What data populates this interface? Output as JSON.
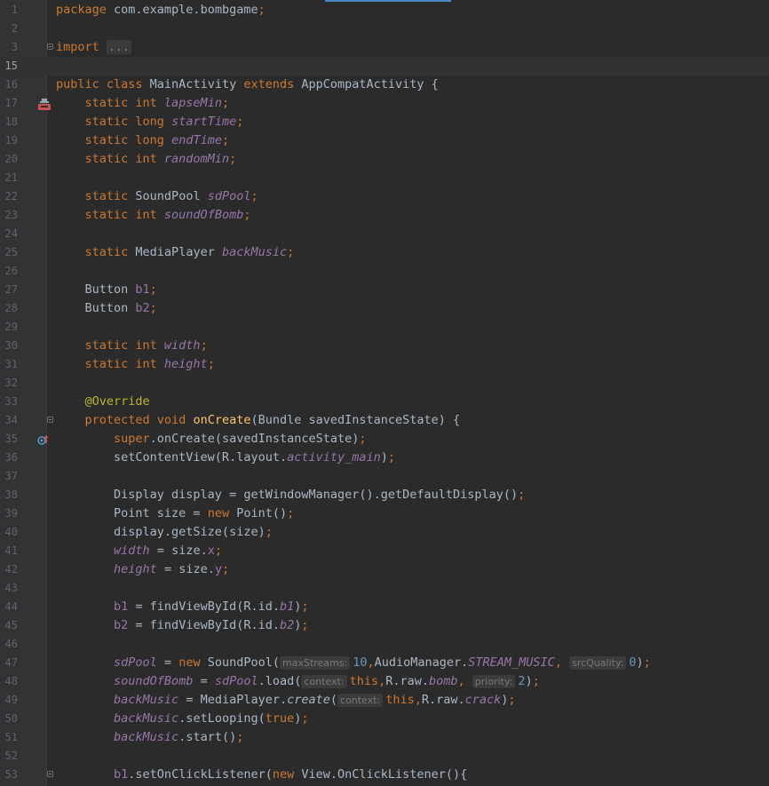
{
  "editor": {
    "lines": [
      {
        "n": "1",
        "tokens": [
          [
            "kw",
            "package "
          ],
          [
            "",
            "com.example.bombgame"
          ],
          [
            "kw",
            ";"
          ]
        ]
      },
      {
        "n": "2",
        "tokens": []
      },
      {
        "n": "3",
        "fold": true,
        "tokens": [
          [
            "kw",
            "import "
          ],
          [
            "folded",
            "..."
          ]
        ]
      },
      {
        "n": "15",
        "current": true,
        "tokens": []
      },
      {
        "n": "16",
        "icon": "class-icon",
        "tokens": [
          [
            "kw",
            "public class "
          ],
          [
            "",
            "MainActivity "
          ],
          [
            "kw",
            "extends "
          ],
          [
            "",
            "AppCompatActivity {"
          ]
        ]
      },
      {
        "n": "17",
        "tokens": [
          [
            "",
            "    "
          ],
          [
            "kw",
            "static int "
          ],
          [
            "fld",
            "lapseMin"
          ],
          [
            "kw",
            ";"
          ]
        ]
      },
      {
        "n": "18",
        "tokens": [
          [
            "",
            "    "
          ],
          [
            "kw",
            "static long "
          ],
          [
            "fld",
            "startTime"
          ],
          [
            "kw",
            ";"
          ]
        ]
      },
      {
        "n": "19",
        "tokens": [
          [
            "",
            "    "
          ],
          [
            "kw",
            "static long "
          ],
          [
            "fld",
            "endTime"
          ],
          [
            "kw",
            ";"
          ]
        ]
      },
      {
        "n": "20",
        "tokens": [
          [
            "",
            "    "
          ],
          [
            "kw",
            "static int "
          ],
          [
            "fld",
            "randomMin"
          ],
          [
            "kw",
            ";"
          ]
        ]
      },
      {
        "n": "21",
        "tokens": []
      },
      {
        "n": "22",
        "tokens": [
          [
            "",
            "    "
          ],
          [
            "kw",
            "static "
          ],
          [
            "",
            "SoundPool "
          ],
          [
            "fld",
            "sdPool"
          ],
          [
            "kw",
            ";"
          ]
        ]
      },
      {
        "n": "23",
        "tokens": [
          [
            "",
            "    "
          ],
          [
            "kw",
            "static int "
          ],
          [
            "fld",
            "soundOfBomb"
          ],
          [
            "kw",
            ";"
          ]
        ]
      },
      {
        "n": "24",
        "tokens": []
      },
      {
        "n": "25",
        "tokens": [
          [
            "",
            "    "
          ],
          [
            "kw",
            "static "
          ],
          [
            "",
            "MediaPlayer "
          ],
          [
            "fld",
            "backMusic"
          ],
          [
            "kw",
            ";"
          ]
        ]
      },
      {
        "n": "26",
        "tokens": []
      },
      {
        "n": "27",
        "tokens": [
          [
            "",
            "    Button "
          ],
          [
            "fldn",
            "b1"
          ],
          [
            "kw",
            ";"
          ]
        ]
      },
      {
        "n": "28",
        "tokens": [
          [
            "",
            "    Button "
          ],
          [
            "fldn",
            "b2"
          ],
          [
            "kw",
            ";"
          ]
        ]
      },
      {
        "n": "29",
        "tokens": []
      },
      {
        "n": "30",
        "tokens": [
          [
            "",
            "    "
          ],
          [
            "kw",
            "static int "
          ],
          [
            "fld",
            "width"
          ],
          [
            "kw",
            ";"
          ]
        ]
      },
      {
        "n": "31",
        "tokens": [
          [
            "",
            "    "
          ],
          [
            "kw",
            "static int "
          ],
          [
            "fld",
            "height"
          ],
          [
            "kw",
            ";"
          ]
        ]
      },
      {
        "n": "32",
        "tokens": []
      },
      {
        "n": "33",
        "tokens": [
          [
            "",
            "    "
          ],
          [
            "ann",
            "@Override"
          ]
        ]
      },
      {
        "n": "34",
        "icon": "override-icon",
        "fold": true,
        "tokens": [
          [
            "",
            "    "
          ],
          [
            "kw",
            "protected void "
          ],
          [
            "mth",
            "onCreate"
          ],
          [
            "",
            "(Bundle savedInstanceState) {"
          ]
        ]
      },
      {
        "n": "35",
        "tokens": [
          [
            "",
            "        "
          ],
          [
            "kw",
            "super"
          ],
          [
            "",
            ".onCreate(savedInstanceState)"
          ],
          [
            "kw",
            ";"
          ]
        ]
      },
      {
        "n": "36",
        "tokens": [
          [
            "",
            "        setContentView(R.layout."
          ],
          [
            "fld",
            "activity_main"
          ],
          [
            "",
            ")"
          ],
          [
            "kw",
            ";"
          ]
        ]
      },
      {
        "n": "37",
        "tokens": []
      },
      {
        "n": "38",
        "tokens": [
          [
            "",
            "        Display display = getWindowManager().getDefaultDisplay()"
          ],
          [
            "kw",
            ";"
          ]
        ]
      },
      {
        "n": "39",
        "tokens": [
          [
            "",
            "        Point size = "
          ],
          [
            "kw",
            "new "
          ],
          [
            "",
            "Point()"
          ],
          [
            "kw",
            ";"
          ]
        ]
      },
      {
        "n": "40",
        "tokens": [
          [
            "",
            "        display.getSize(size)"
          ],
          [
            "kw",
            ";"
          ]
        ]
      },
      {
        "n": "41",
        "tokens": [
          [
            "",
            "        "
          ],
          [
            "fld",
            "width "
          ],
          [
            "",
            "= size."
          ],
          [
            "fldn",
            "x"
          ],
          [
            "kw",
            ";"
          ]
        ]
      },
      {
        "n": "42",
        "tokens": [
          [
            "",
            "        "
          ],
          [
            "fld",
            "height "
          ],
          [
            "",
            "= size."
          ],
          [
            "fldn",
            "y"
          ],
          [
            "kw",
            ";"
          ]
        ]
      },
      {
        "n": "43",
        "tokens": []
      },
      {
        "n": "44",
        "tokens": [
          [
            "",
            "        "
          ],
          [
            "fldn",
            "b1 "
          ],
          [
            "",
            "= findViewById(R.id."
          ],
          [
            "fld",
            "b1"
          ],
          [
            "",
            ")"
          ],
          [
            "kw",
            ";"
          ]
        ]
      },
      {
        "n": "45",
        "tokens": [
          [
            "",
            "        "
          ],
          [
            "fldn",
            "b2 "
          ],
          [
            "",
            "= findViewById(R.id."
          ],
          [
            "fld",
            "b2"
          ],
          [
            "",
            ")"
          ],
          [
            "kw",
            ";"
          ]
        ]
      },
      {
        "n": "46",
        "tokens": []
      },
      {
        "n": "47",
        "tokens": [
          [
            "",
            "        "
          ],
          [
            "fld",
            "sdPool "
          ],
          [
            "",
            "= "
          ],
          [
            "kw",
            "new "
          ],
          [
            "",
            "SoundPool("
          ],
          [
            "hint",
            "maxStreams:"
          ],
          [
            "num",
            "10"
          ],
          [
            "kw",
            ","
          ],
          [
            "",
            "AudioManager."
          ],
          [
            "fld",
            "STREAM_MUSIC"
          ],
          [
            "kw",
            ", "
          ],
          [
            "hint",
            "srcQuality:"
          ],
          [
            "num",
            "0"
          ],
          [
            "",
            ")"
          ],
          [
            "kw",
            ";"
          ]
        ]
      },
      {
        "n": "48",
        "tokens": [
          [
            "",
            "        "
          ],
          [
            "fld",
            "soundOfBomb "
          ],
          [
            "",
            "= "
          ],
          [
            "fld",
            "sdPool"
          ],
          [
            "",
            ".load("
          ],
          [
            "hint",
            "context:"
          ],
          [
            "kw",
            "this,"
          ],
          [
            "",
            "R.raw."
          ],
          [
            "fld",
            "bomb"
          ],
          [
            "kw",
            ", "
          ],
          [
            "hint",
            "priority:"
          ],
          [
            "num",
            "2"
          ],
          [
            "",
            ")"
          ],
          [
            "kw",
            ";"
          ]
        ]
      },
      {
        "n": "49",
        "tokens": [
          [
            "",
            "        "
          ],
          [
            "fld",
            "backMusic "
          ],
          [
            "",
            "= MediaPlayer."
          ],
          [
            "stc",
            "create"
          ],
          [
            "",
            "("
          ],
          [
            "hint",
            "context:"
          ],
          [
            "kw",
            "this,"
          ],
          [
            "",
            "R.raw."
          ],
          [
            "fld",
            "crack"
          ],
          [
            "",
            ")"
          ],
          [
            "kw",
            ";"
          ]
        ]
      },
      {
        "n": "50",
        "tokens": [
          [
            "",
            "        "
          ],
          [
            "fld",
            "backMusic"
          ],
          [
            "",
            ".setLooping("
          ],
          [
            "kw",
            "true"
          ],
          [
            "",
            ")"
          ],
          [
            "kw",
            ";"
          ]
        ]
      },
      {
        "n": "51",
        "tokens": [
          [
            "",
            "        "
          ],
          [
            "fld",
            "backMusic"
          ],
          [
            "",
            ".start()"
          ],
          [
            "kw",
            ";"
          ]
        ]
      },
      {
        "n": "52",
        "tokens": []
      },
      {
        "n": "53",
        "fold": true,
        "tokens": [
          [
            "",
            "        "
          ],
          [
            "fldn",
            "b1"
          ],
          [
            "",
            ".setOnClickListener("
          ],
          [
            "kw",
            "new "
          ],
          [
            "",
            "View.OnClickListener(){"
          ]
        ]
      }
    ]
  },
  "colors": {
    "background": "#2b2b2b",
    "gutter": "#313335",
    "keyword": "#cc7832",
    "field": "#9876aa",
    "method": "#ffc66d",
    "number": "#6897bb",
    "annotation": "#bbb529"
  }
}
